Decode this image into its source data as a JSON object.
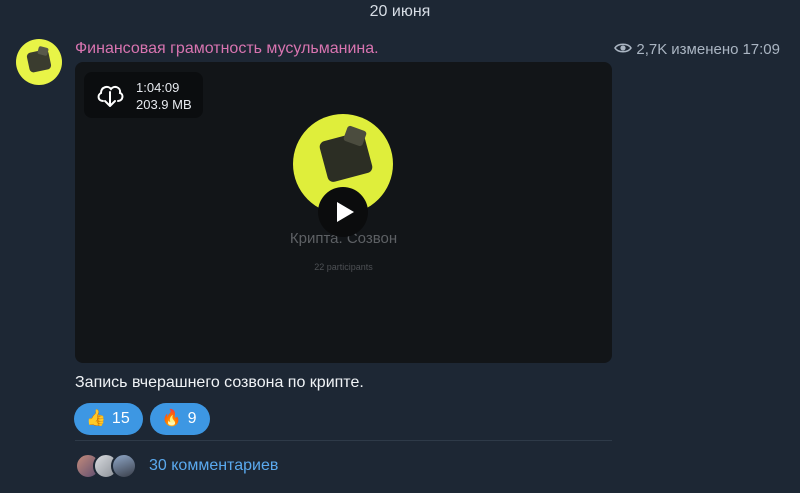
{
  "date_separator": "20 июня",
  "post": {
    "channel_name": "Финансовая грамотность мусульманина.",
    "views": "2,7K",
    "edited_label": "изменено",
    "time": "17:09",
    "video": {
      "duration": "1:04:09",
      "size": "203.9 MB",
      "title": "Крипта. Созвон",
      "participants": "22 participants"
    },
    "caption": "Запись вчерашнего созвона по крипте.",
    "reactions": [
      {
        "emoji": "👍",
        "count": "15"
      },
      {
        "emoji": "🔥",
        "count": "9"
      }
    ],
    "comments_label": "30 комментариев"
  },
  "colors": {
    "background": "#1d2734",
    "channel_name": "#d874b0",
    "reaction_bg": "#3d97e3",
    "link": "#5aa9ee",
    "avatar_yellow": "#e8f447"
  },
  "icons": [
    "eye-icon",
    "download-icon",
    "play-icon"
  ]
}
